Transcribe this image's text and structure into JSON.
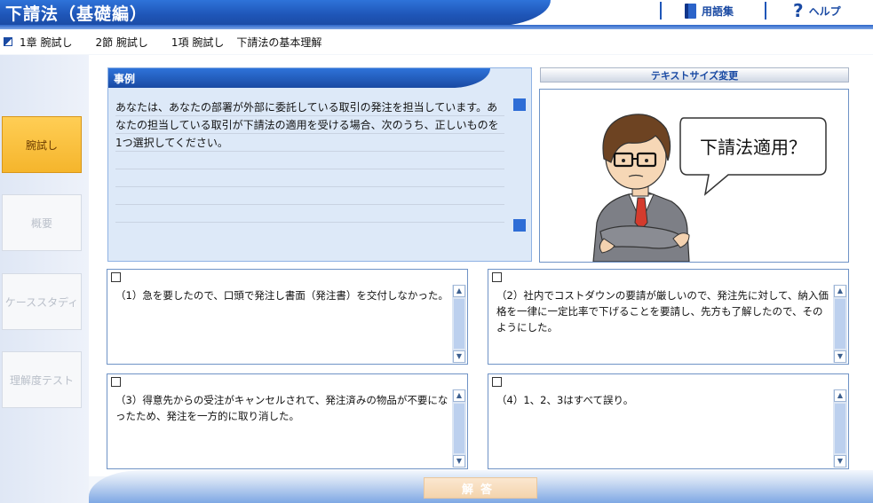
{
  "header": {
    "title": "下請法（基礎編）",
    "glossary_label": "用語集",
    "help_label": "ヘルプ"
  },
  "breadcrumb": [
    "1章 腕試し",
    "2節 腕試し",
    "1項 腕試し",
    "下請法の基本理解"
  ],
  "sidebar": {
    "items": [
      {
        "label": "腕試し",
        "active": true
      },
      {
        "label": "概要",
        "active": false
      },
      {
        "label": "ケーススタディ",
        "active": false
      },
      {
        "label": "理解度テスト",
        "active": false
      }
    ]
  },
  "case": {
    "label": "事例",
    "text": "あなたは、あなたの部署が外部に委託している取引の発注を担当しています。あなたの担当している取引が下請法の適用を受ける場合、次のうち、正しいものを1つ選択してください。"
  },
  "textsize_label": "テキストサイズ変更",
  "illustration": {
    "speech": "下請法適用？"
  },
  "options": [
    {
      "text": "（1）急を要したので、口頭で発注し書面（発注書）を交付しなかった。",
      "checked": false
    },
    {
      "text": "（2）社内でコストダウンの要請が厳しいので、発注先に対して、納入価格を一律に一定比率で下げることを要請し、先方も了解したので、そのようにした。",
      "checked": false
    },
    {
      "text": "（3）得意先からの受注がキャンセルされて、発注済みの物品が不要になったため、発注を一方的に取り消した。",
      "checked": false
    },
    {
      "text": "（4）1、2、3はすべて誤り。",
      "checked": false
    }
  ],
  "footer": {
    "answer_label": "解答"
  },
  "icons": {
    "glossary": "book-icon",
    "help": "question-mark-icon",
    "breadcrumb": "breadcrumb-marker-icon",
    "scroll_up": "arrow-up-icon",
    "scroll_down": "arrow-down-icon"
  },
  "colors": {
    "brand_blue": "#1f56b8",
    "active_tab": "#f5b52c",
    "panel_bg": "#dde9f8"
  }
}
